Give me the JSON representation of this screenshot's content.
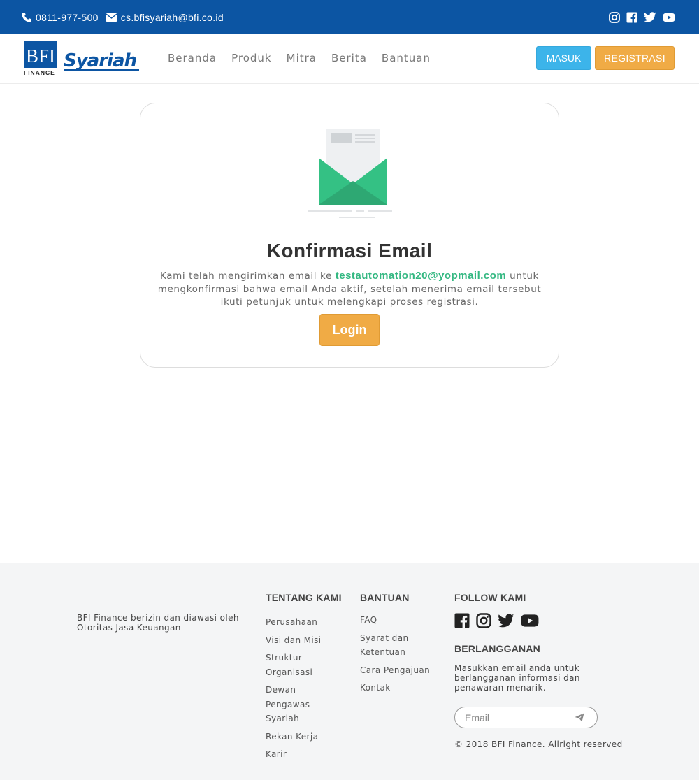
{
  "topbar": {
    "phone": "0811-977-500",
    "email": "cs.bfisyariah@bfi.co.id",
    "social_icons": [
      "instagram-icon",
      "facebook-icon",
      "twitter-icon",
      "youtube-icon"
    ]
  },
  "brand": {
    "logo_main": "BFI",
    "logo_sub": "FINANCE",
    "logo_script": "Syariah",
    "colors": {
      "primary": "#0c55a3",
      "accent_orange": "#f0ab45",
      "accent_blue": "#3cb4ea",
      "success_green": "#34b882"
    }
  },
  "nav": {
    "items": [
      "Beranda",
      "Produk",
      "Mitra",
      "Berita",
      "Bantuan"
    ],
    "masuk_label": "MASUK",
    "registrasi_label": "REGISTRASI"
  },
  "confirmation": {
    "title": "Konfirmasi Email",
    "message_before": "Kami telah mengirimkan email ke ",
    "email": "testautomation20@yopmail.com",
    "message_after": " untuk mengkonfirmasi bahwa email Anda aktif, setelah menerima email tersebut ikuti petunjuk untuk melengkapi proses registrasi.",
    "login_label": "Login"
  },
  "footer": {
    "about": "BFI Finance berizin dan diawasi oleh Otoritas Jasa Keuangan",
    "tentang": {
      "title": "TENTANG KAMI",
      "links": [
        "Perusahaan",
        "Visi dan Misi",
        "Struktur Organisasi",
        "Dewan Pengawas Syariah",
        "Rekan Kerja",
        "Karir"
      ]
    },
    "bantuan": {
      "title": "BANTUAN",
      "links": [
        "FAQ",
        "Syarat dan Ketentuan",
        "Cara Pengajuan",
        "Kontak"
      ]
    },
    "follow": {
      "title": "FOLLOW KAMI",
      "icons": [
        "facebook-icon",
        "instagram-icon",
        "twitter-icon",
        "youtube-icon"
      ]
    },
    "subscribe": {
      "title": "BERLANGGANAN",
      "description": "Masukkan email anda untuk berlangganan informasi dan penawaran menarik.",
      "placeholder": "Email"
    },
    "copyright": "© 2018 BFI Finance. Allright reserved"
  }
}
